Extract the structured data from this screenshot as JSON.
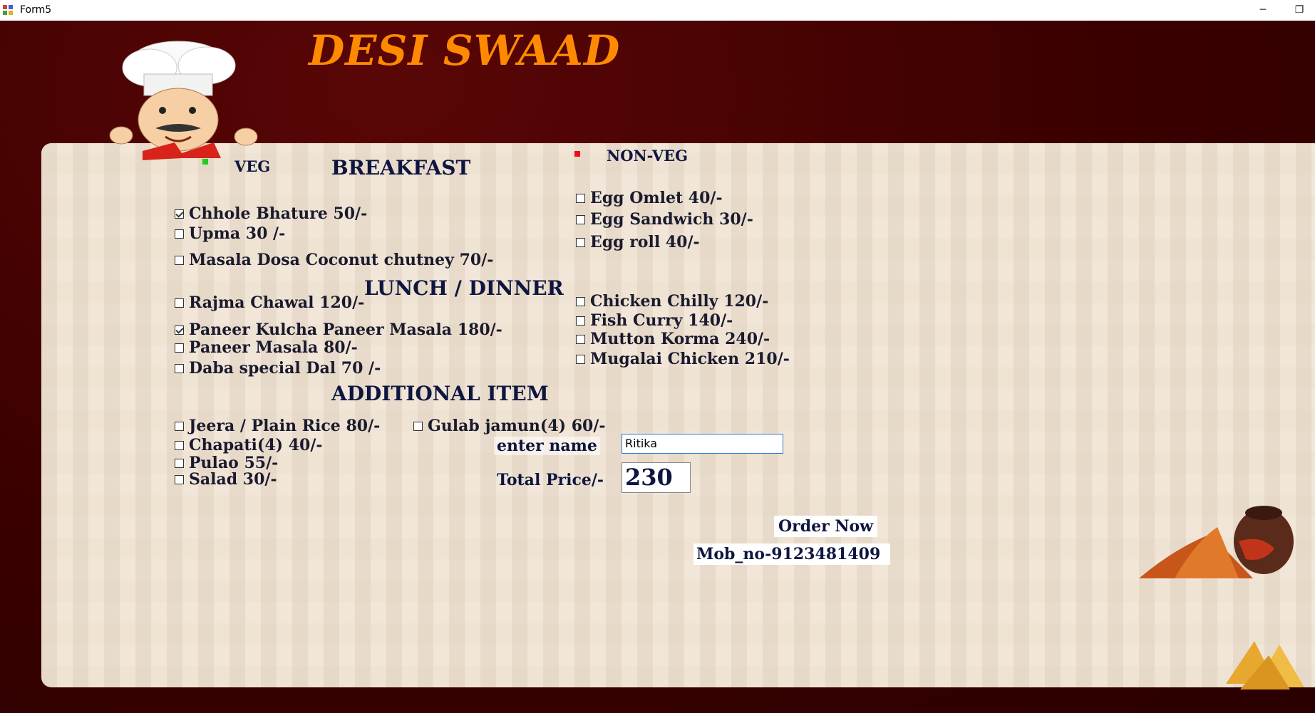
{
  "window": {
    "title": "Form5",
    "minimize_glyph": "─",
    "restore_glyph": "❐"
  },
  "brand": "DESI SWAAD",
  "colors": {
    "brand": "#ff8a00",
    "veg_dot": "#22cc22",
    "nonveg_dot": "#ee1111"
  },
  "labels": {
    "veg": "VEG",
    "nonveg": "NON-VEG",
    "breakfast": "BREAKFAST",
    "lunch_dinner": "LUNCH / DINNER",
    "additional": "ADDITIONAL ITEM",
    "enter_name": "enter name",
    "total_price": "Total Price/-"
  },
  "veg_breakfast": [
    {
      "label": "Chhole Bhature 50/-",
      "checked": true
    },
    {
      "label": "Upma 30 /-",
      "checked": false
    },
    {
      "label": "Masala Dosa  Coconut chutney 70/-",
      "checked": false
    }
  ],
  "veg_lunch": [
    {
      "label": "Rajma Chawal 120/-",
      "checked": false
    },
    {
      "label": "Paneer Kulcha  Paneer Masala 180/-",
      "checked": true
    },
    {
      "label": "Paneer Masala 80/-",
      "checked": false
    },
    {
      "label": " Daba special Dal 70 /-",
      "checked": false
    }
  ],
  "nonveg_breakfast": [
    {
      "label": "Egg Omlet 40/-",
      "checked": false
    },
    {
      "label": "Egg Sandwich 30/-",
      "checked": false
    },
    {
      "label": "Egg roll 40/-",
      "checked": false
    }
  ],
  "nonveg_lunch": [
    {
      "label": "Chicken Chilly 120/-",
      "checked": false
    },
    {
      "label": "Fish Curry 140/-",
      "checked": false
    },
    {
      "label": "Mutton Korma 240/-",
      "checked": false
    },
    {
      "label": "Mugalai Chicken 210/-",
      "checked": false
    }
  ],
  "additional": [
    {
      "label": "Jeera / Plain Rice 80/-",
      "checked": false
    },
    {
      "label": "Chapati(4) 40/-",
      "checked": false
    },
    {
      "label": "Pulao 55/-",
      "checked": false
    },
    {
      "label": "Salad 30/-",
      "checked": false
    },
    {
      "label": "Gulab jamun(4) 60/-",
      "checked": false
    }
  ],
  "form": {
    "name_value": "Ritika",
    "total_price": "230"
  },
  "actions": {
    "order_now": "Order Now",
    "mobile": "Mob_no-9123481409"
  }
}
